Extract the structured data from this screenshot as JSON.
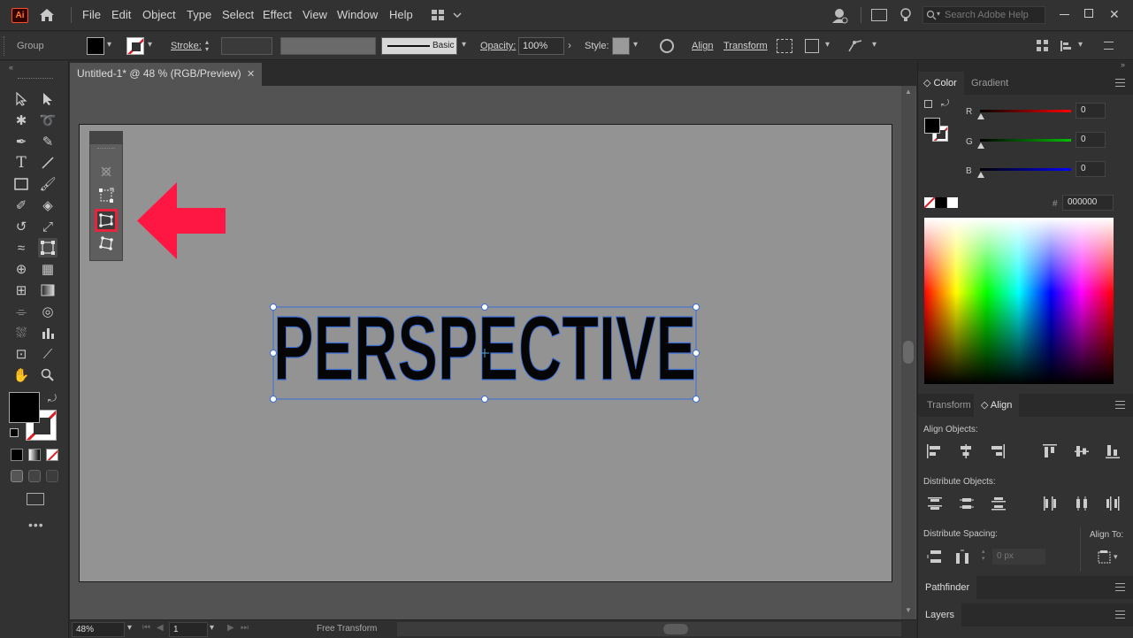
{
  "app": {
    "logo": "Ai"
  },
  "menu": [
    "File",
    "Edit",
    "Object",
    "Type",
    "Select",
    "Effect",
    "View",
    "Window",
    "Help"
  ],
  "search": {
    "placeholder": "Search Adobe Help"
  },
  "control": {
    "selection_type": "Group",
    "stroke_label": "Stroke:",
    "brush_label": "Basic",
    "opacity_label": "Opacity:",
    "opacity_value": "100%",
    "style_label": "Style:",
    "align_label": "Align",
    "transform_label": "Transform"
  },
  "document": {
    "tab_title": "Untitled-1* @ 48 % (RGB/Preview)",
    "artwork_text": "PERSPECTIVE"
  },
  "free_transform_widget": {
    "tools": [
      "constrain-icon",
      "free-transform-icon",
      "perspective-distort-icon",
      "free-distort-icon"
    ],
    "active_tool": "perspective-distort-icon"
  },
  "status": {
    "zoom": "48%",
    "artboard": "1",
    "tool": "Free Transform"
  },
  "color_panel": {
    "tabs": [
      "Color",
      "Gradient"
    ],
    "channels": [
      {
        "label": "R",
        "value": "0",
        "color": "#ff0000"
      },
      {
        "label": "G",
        "value": "0",
        "color": "#00c000"
      },
      {
        "label": "B",
        "value": "0",
        "color": "#0000ff"
      }
    ],
    "hex_label": "#",
    "hex_value": "000000"
  },
  "align_panel": {
    "tabs": [
      "Transform",
      "Align"
    ],
    "align_objects": "Align Objects:",
    "distribute_objects": "Distribute Objects:",
    "distribute_spacing": "Distribute Spacing:",
    "align_to": "Align To:",
    "spacing_value": "0 px"
  },
  "collapsed_panels": [
    "Pathfinder",
    "Layers"
  ],
  "colors": {
    "accent_arrow": "#ff1744",
    "highlight": "#e8243c",
    "selection": "#3a6fd8"
  }
}
